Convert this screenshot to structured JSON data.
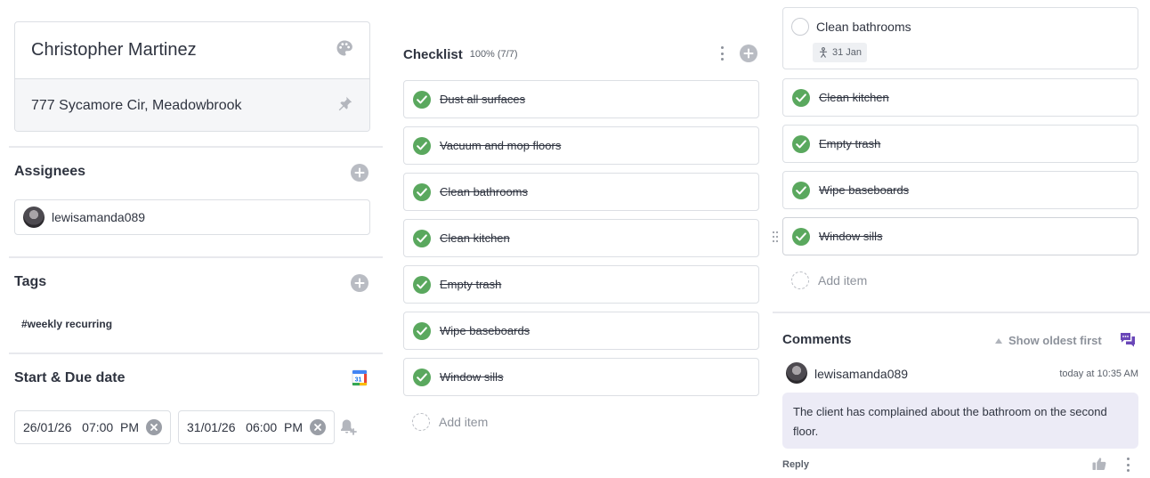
{
  "client": {
    "name": "Christopher Martinez",
    "address": "777 Sycamore Cir, Meadowbrook"
  },
  "assignees": {
    "title": "Assignees",
    "items": [
      {
        "username": "lewisamanda089"
      }
    ]
  },
  "tags": {
    "title": "Tags",
    "items": [
      "#weekly recurring"
    ]
  },
  "dates": {
    "title": "Start & Due date",
    "calendar_day": "31",
    "start": "26/01/26   07:00  PM",
    "due": "31/01/26   06:00  PM"
  },
  "checklist_a": {
    "title": "Checklist",
    "progress": "100% (7/7)",
    "items": [
      "Dust all surfaces",
      "Vacuum and mop floors",
      "Clean bathrooms",
      "Clean kitchen",
      "Empty trash",
      "Wipe baseboards",
      "Window sills"
    ],
    "add_label": "Add item"
  },
  "checklist_b": {
    "pending": {
      "label": "Clean bathrooms",
      "date": "31 Jan"
    },
    "items": [
      "Clean kitchen",
      "Empty trash",
      "Wipe baseboards",
      "Window sills"
    ],
    "add_label": "Add item"
  },
  "comments": {
    "title": "Comments",
    "sort_label": "Show oldest first",
    "items": [
      {
        "author": "lewisamanda089",
        "time": "today at 10:35 AM",
        "text": "The client has complained about the bathroom on the second floor.",
        "reply_label": "Reply"
      }
    ]
  },
  "colors": {
    "check_green": "#5aa85e",
    "comment_bubble": "#ecebf6",
    "comments_icon": "#6a47b8"
  }
}
